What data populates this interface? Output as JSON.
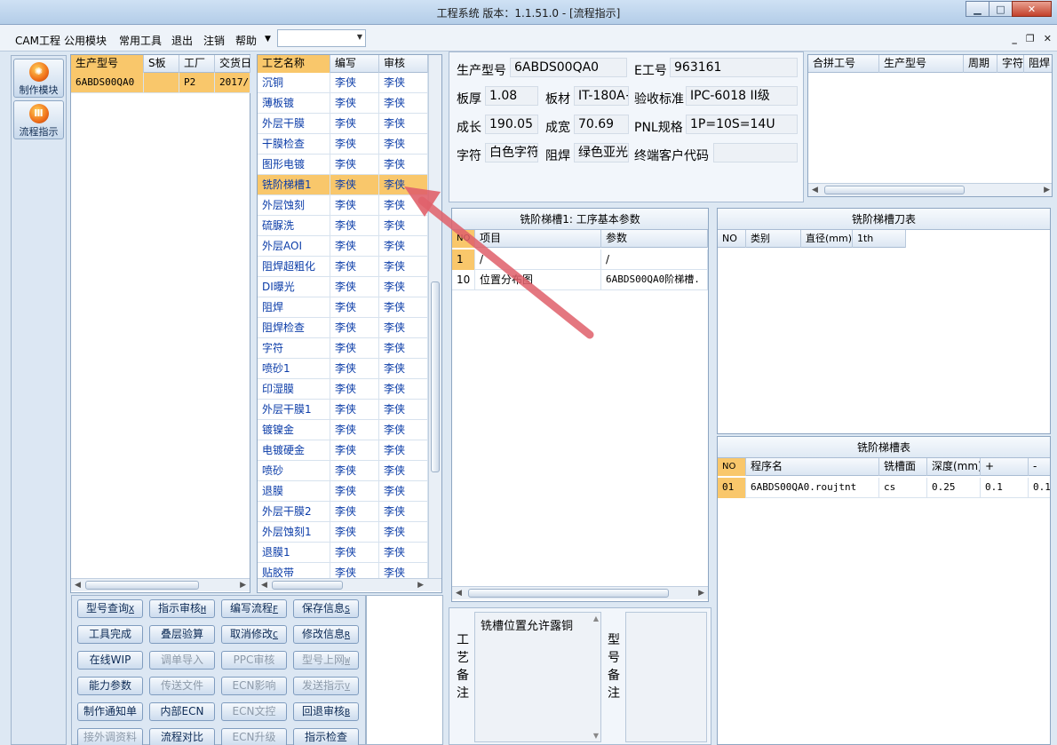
{
  "window": {
    "title": "工程系统   版本：1.1.51.0 - [流程指示]"
  },
  "menu": [
    "CAM工程",
    "公用模块",
    "常用工具",
    "退出",
    "注销",
    "帮助"
  ],
  "mdi_controls": [
    "_",
    "❐",
    "✕"
  ],
  "modules": [
    {
      "label": "制作模块",
      "icon": "fire-icon"
    },
    {
      "label": "流程指示",
      "icon": "flow-icon"
    }
  ],
  "model_list": {
    "columns": [
      "生产型号",
      "S板",
      "工厂",
      "交货日"
    ],
    "rows": [
      {
        "model": "6ABDS00QA0",
        "s": "",
        "factory": "P2",
        "date": "2017/1"
      }
    ]
  },
  "process_list": {
    "columns": [
      "工艺名称",
      "编写",
      "审核"
    ],
    "rows": [
      [
        "沉铜",
        "李侠",
        "李侠"
      ],
      [
        "薄板镀",
        "李侠",
        "李侠"
      ],
      [
        "外层干膜",
        "李侠",
        "李侠"
      ],
      [
        "干膜检查",
        "李侠",
        "李侠"
      ],
      [
        "图形电镀",
        "李侠",
        "李侠"
      ],
      [
        "铣阶梯槽1",
        "李侠",
        "李侠"
      ],
      [
        "外层蚀刻",
        "李侠",
        "李侠"
      ],
      [
        "硫脲洗",
        "李侠",
        "李侠"
      ],
      [
        "外层AOI",
        "李侠",
        "李侠"
      ],
      [
        "阻焊超粗化",
        "李侠",
        "李侠"
      ],
      [
        "DI曝光",
        "李侠",
        "李侠"
      ],
      [
        "阻焊",
        "李侠",
        "李侠"
      ],
      [
        "阻焊检查",
        "李侠",
        "李侠"
      ],
      [
        "字符",
        "李侠",
        "李侠"
      ],
      [
        "喷砂1",
        "李侠",
        "李侠"
      ],
      [
        "印湿膜",
        "李侠",
        "李侠"
      ],
      [
        "外层干膜1",
        "李侠",
        "李侠"
      ],
      [
        "镀镍金",
        "李侠",
        "李侠"
      ],
      [
        "电镀硬金",
        "李侠",
        "李侠"
      ],
      [
        "喷砂",
        "李侠",
        "李侠"
      ],
      [
        "退膜",
        "李侠",
        "李侠"
      ],
      [
        "外层干膜2",
        "李侠",
        "李侠"
      ],
      [
        "外层蚀刻1",
        "李侠",
        "李侠"
      ],
      [
        "退膜1",
        "李侠",
        "李侠"
      ],
      [
        "贴胶带",
        "李侠",
        "李侠"
      ]
    ],
    "selected_index": 5
  },
  "info": {
    "prod_model_label": "生产型号",
    "prod_model": "6ABDS00QA0",
    "e_no_label": "E工号",
    "e_no": "963161",
    "thickness_label": "板厚",
    "thickness": "1.08",
    "material_label": "板材",
    "material": "IT-180A+",
    "standard_label": "验收标准",
    "standard": "IPC-6018 II级",
    "length_label": "成长",
    "length": "190.05",
    "width_label": "成宽",
    "width": "70.69",
    "pnl_label": "PNL规格",
    "pnl": "1P=10S=14U",
    "char_label": "字符",
    "char": "白色字符",
    "mask_label": "阻焊",
    "mask": "绿色亚光",
    "cust_label": "终端客户代码",
    "cust": ""
  },
  "merge_table": {
    "columns": [
      "合拼工号",
      "生产型号",
      "周期",
      "字符",
      "阻焊"
    ]
  },
  "params": {
    "title": "铣阶梯槽1: 工序基本参数",
    "columns": [
      "NO",
      "项目",
      "参数"
    ],
    "rows": [
      [
        "1",
        "/",
        "/"
      ],
      [
        "10",
        "位置分布图",
        "6ABDS00QA0阶梯槽."
      ]
    ]
  },
  "tool_table": {
    "title": "铣阶梯槽刀表",
    "columns": [
      "NO",
      "类别",
      "直径(mm)",
      "1th"
    ]
  },
  "groove_table": {
    "title": "铣阶梯槽表",
    "columns": [
      "NO",
      "程序名",
      "铣槽面",
      "深度(mm)",
      "+",
      "-"
    ],
    "rows": [
      [
        "01",
        "6ABDS00QA0.roujtnt",
        "cs",
        "0.25",
        "0.1",
        "0.1"
      ]
    ]
  },
  "buttons": [
    [
      "型号查询",
      "X",
      true
    ],
    [
      "指示审核",
      "H",
      true
    ],
    [
      "编写流程",
      "F",
      true
    ],
    [
      "保存信息",
      "S",
      true
    ],
    [
      "工具完成",
      "",
      true
    ],
    [
      "叠层验算",
      "",
      true
    ],
    [
      "取消修改",
      "C",
      true
    ],
    [
      "修改信息",
      "R",
      true
    ],
    [
      "在线WIP",
      "",
      true
    ],
    [
      "调单导入",
      "",
      false
    ],
    [
      "PPC审核",
      "",
      false
    ],
    [
      "型号上网",
      "W",
      false
    ],
    [
      "能力参数",
      "",
      true
    ],
    [
      "传送文件",
      "",
      false
    ],
    [
      "ECN影响",
      "",
      false
    ],
    [
      "发送指示",
      "V",
      false
    ],
    [
      "制作通知单",
      "",
      true
    ],
    [
      "内部ECN",
      "",
      true
    ],
    [
      "ECN文控",
      "",
      false
    ],
    [
      "回退审核",
      "B",
      true
    ],
    [
      "接外调资料",
      "",
      false
    ],
    [
      "流程对比",
      "",
      true
    ],
    [
      "ECN升级",
      "",
      false
    ],
    [
      "指示检查",
      "",
      true
    ]
  ],
  "remarks": {
    "process_label": "工艺备注",
    "process_text": "铣槽位置允许露铜",
    "model_label": "型号备注",
    "model_text": ""
  },
  "colors": {
    "selection": "#f9c76b",
    "link_text": "#0b3ca8",
    "arrow": "#e0606a"
  }
}
